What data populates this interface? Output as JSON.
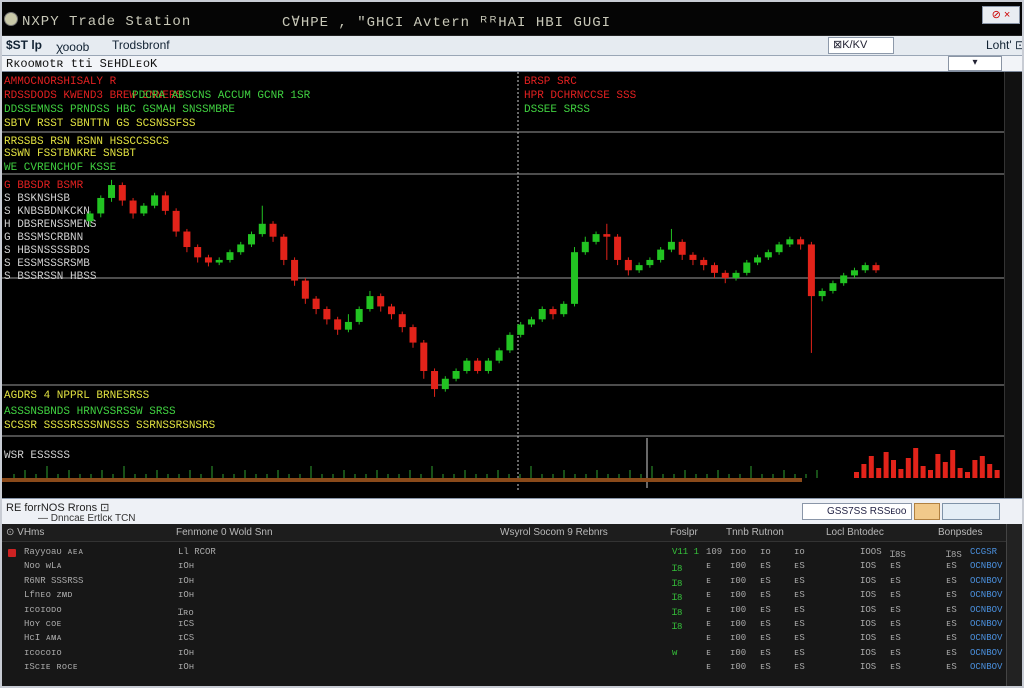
{
  "window": {
    "title": "NXPY Trade Station",
    "title_extra": "C∀HPE , \"GHCI Avtern ᴿᴿHAI HBI GUGI",
    "close_label": "⊘ ×"
  },
  "toolbar": {
    "items": [
      "$ST lp",
      "ꭓooob",
      "Trodsbronf"
    ],
    "right_field": "⊠K/KV",
    "right_label": "Loht' ⊡"
  },
  "toolbar2": {
    "label": "Rᴋooᴍᴏtʀ tti  SᴇHDLᴇᴏK",
    "combo": "▾"
  },
  "chart": {
    "left_legend_lines": [
      {
        "text": "AMMOCNORSHISALY R",
        "color": "#e02020"
      },
      {
        "text": "RDSSDODS KWEND3  BREW ENNERS",
        "color": "#e02020"
      },
      {
        "text": "DDSSEMNSS PRNDSS HBC  GSMAH SNSSMBRE",
        "color": "#40d040"
      },
      {
        "text": "SBTV  RSST  SBNTTN  GS  SCSNSSFSS",
        "color": "#e0e040"
      }
    ],
    "mid_legend_lines": [
      {
        "text": "BRSP SRC",
        "color": "#e02020"
      },
      {
        "text": "HPR DCHRNCCSE SSS",
        "color": "#e02020"
      },
      {
        "text": "DSSEE  SRSS",
        "color": "#40d040"
      }
    ],
    "top_right_legend": "PDCRA ABSCNS ACCUM  GCNR 1SR",
    "sub_header_1": "RRSSBS   RSN RSNN  HSSCCSSCS",
    "sub_header_2": "SSWN  FSSTBNKRE  SNSBT",
    "indicator_label": "WE   CVRENCHOF KSSE",
    "price_labels": [
      "G  BBSDR BSMR",
      "S  BSKNSHSB",
      "S  KNBSBDNKCKN",
      "H  DBSRENSSMENS",
      "G  BSSMSCRBNN",
      "S  HBSNSSSSBDS",
      "S  ESSMSSSRSMB",
      "S  BSSRSSN  HBSS"
    ],
    "lower_legend_1": "AGDRS  4  NPPRL  BRNESRSS",
    "lower_legend_2": "ASSSNSBNDS  HRNVSSRSSW SRSS",
    "lower_legend_3": "SCSSR  SSSSRSSSNNSSS  SSRNSSRSNSRS",
    "volume_label": "WSR  ESSSSS"
  },
  "chart_data": {
    "type": "candlestick",
    "candles": [
      {
        "o": 180,
        "c": 186,
        "h": 188,
        "l": 176
      },
      {
        "o": 186,
        "c": 198,
        "h": 200,
        "l": 183
      },
      {
        "o": 198,
        "c": 208,
        "h": 212,
        "l": 195
      },
      {
        "o": 208,
        "c": 196,
        "h": 210,
        "l": 192
      },
      {
        "o": 196,
        "c": 186,
        "h": 198,
        "l": 182
      },
      {
        "o": 186,
        "c": 192,
        "h": 194,
        "l": 184
      },
      {
        "o": 192,
        "c": 200,
        "h": 202,
        "l": 190
      },
      {
        "o": 200,
        "c": 188,
        "h": 203,
        "l": 185
      },
      {
        "o": 188,
        "c": 172,
        "h": 190,
        "l": 168
      },
      {
        "o": 172,
        "c": 160,
        "h": 174,
        "l": 156
      },
      {
        "o": 160,
        "c": 152,
        "h": 162,
        "l": 148
      },
      {
        "o": 152,
        "c": 148,
        "h": 154,
        "l": 145
      },
      {
        "o": 148,
        "c": 150,
        "h": 152,
        "l": 146
      },
      {
        "o": 150,
        "c": 156,
        "h": 158,
        "l": 148
      },
      {
        "o": 156,
        "c": 162,
        "h": 164,
        "l": 154
      },
      {
        "o": 162,
        "c": 170,
        "h": 172,
        "l": 160
      },
      {
        "o": 170,
        "c": 178,
        "h": 192,
        "l": 168
      },
      {
        "o": 178,
        "c": 168,
        "h": 180,
        "l": 164
      },
      {
        "o": 168,
        "c": 150,
        "h": 170,
        "l": 146
      },
      {
        "o": 150,
        "c": 134,
        "h": 152,
        "l": 130
      },
      {
        "o": 134,
        "c": 120,
        "h": 136,
        "l": 116
      },
      {
        "o": 120,
        "c": 112,
        "h": 122,
        "l": 108
      },
      {
        "o": 112,
        "c": 104,
        "h": 114,
        "l": 100
      },
      {
        "o": 104,
        "c": 96,
        "h": 106,
        "l": 92
      },
      {
        "o": 96,
        "c": 102,
        "h": 108,
        "l": 94
      },
      {
        "o": 102,
        "c": 112,
        "h": 114,
        "l": 100
      },
      {
        "o": 112,
        "c": 122,
        "h": 126,
        "l": 110
      },
      {
        "o": 122,
        "c": 114,
        "h": 124,
        "l": 110
      },
      {
        "o": 114,
        "c": 108,
        "h": 116,
        "l": 104
      },
      {
        "o": 108,
        "c": 98,
        "h": 110,
        "l": 94
      },
      {
        "o": 98,
        "c": 86,
        "h": 100,
        "l": 82
      },
      {
        "o": 86,
        "c": 64,
        "h": 88,
        "l": 58
      },
      {
        "o": 64,
        "c": 50,
        "h": 66,
        "l": 44
      },
      {
        "o": 50,
        "c": 58,
        "h": 60,
        "l": 48
      },
      {
        "o": 58,
        "c": 64,
        "h": 66,
        "l": 56
      },
      {
        "o": 64,
        "c": 72,
        "h": 74,
        "l": 62
      },
      {
        "o": 72,
        "c": 64,
        "h": 74,
        "l": 62
      },
      {
        "o": 64,
        "c": 72,
        "h": 74,
        "l": 62
      },
      {
        "o": 72,
        "c": 80,
        "h": 82,
        "l": 70
      },
      {
        "o": 80,
        "c": 92,
        "h": 94,
        "l": 78
      },
      {
        "o": 92,
        "c": 100,
        "h": 102,
        "l": 90
      },
      {
        "o": 100,
        "c": 104,
        "h": 106,
        "l": 98
      },
      {
        "o": 104,
        "c": 112,
        "h": 114,
        "l": 102
      },
      {
        "o": 112,
        "c": 108,
        "h": 114,
        "l": 104
      },
      {
        "o": 108,
        "c": 116,
        "h": 118,
        "l": 106
      },
      {
        "o": 116,
        "c": 156,
        "h": 160,
        "l": 114
      },
      {
        "o": 156,
        "c": 164,
        "h": 168,
        "l": 154
      },
      {
        "o": 164,
        "c": 170,
        "h": 172,
        "l": 162
      },
      {
        "o": 170,
        "c": 168,
        "h": 178,
        "l": 150
      },
      {
        "o": 168,
        "c": 150,
        "h": 170,
        "l": 146
      },
      {
        "o": 150,
        "c": 142,
        "h": 152,
        "l": 138
      },
      {
        "o": 142,
        "c": 146,
        "h": 148,
        "l": 140
      },
      {
        "o": 146,
        "c": 150,
        "h": 152,
        "l": 144
      },
      {
        "o": 150,
        "c": 158,
        "h": 160,
        "l": 148
      },
      {
        "o": 158,
        "c": 164,
        "h": 174,
        "l": 156
      },
      {
        "o": 164,
        "c": 154,
        "h": 166,
        "l": 150
      },
      {
        "o": 154,
        "c": 150,
        "h": 156,
        "l": 146
      },
      {
        "o": 150,
        "c": 146,
        "h": 152,
        "l": 142
      },
      {
        "o": 146,
        "c": 140,
        "h": 148,
        "l": 136
      },
      {
        "o": 140,
        "c": 136,
        "h": 142,
        "l": 132
      },
      {
        "o": 136,
        "c": 140,
        "h": 142,
        "l": 134
      },
      {
        "o": 140,
        "c": 148,
        "h": 150,
        "l": 138
      },
      {
        "o": 148,
        "c": 152,
        "h": 154,
        "l": 146
      },
      {
        "o": 152,
        "c": 156,
        "h": 158,
        "l": 150
      },
      {
        "o": 156,
        "c": 162,
        "h": 164,
        "l": 154
      },
      {
        "o": 162,
        "c": 166,
        "h": 168,
        "l": 160
      },
      {
        "o": 166,
        "c": 162,
        "h": 168,
        "l": 158
      },
      {
        "o": 162,
        "c": 122,
        "h": 164,
        "l": 78
      },
      {
        "o": 122,
        "c": 126,
        "h": 128,
        "l": 118
      },
      {
        "o": 126,
        "c": 132,
        "h": 134,
        "l": 124
      },
      {
        "o": 132,
        "c": 138,
        "h": 140,
        "l": 130
      },
      {
        "o": 138,
        "c": 142,
        "h": 144,
        "l": 136
      },
      {
        "o": 142,
        "c": 146,
        "h": 148,
        "l": 140
      },
      {
        "o": 146,
        "c": 142,
        "h": 148,
        "l": 140
      }
    ],
    "volume": [
      1,
      2,
      1,
      3,
      1,
      2,
      1,
      1,
      2,
      1,
      3,
      1,
      1,
      2,
      1,
      1,
      2,
      1,
      3,
      1,
      1,
      2,
      1,
      1,
      2,
      1,
      1,
      3,
      1,
      1,
      2,
      1,
      1,
      2,
      1,
      1,
      2,
      1,
      3,
      1,
      1,
      2,
      1,
      1,
      2,
      1,
      1,
      3,
      1,
      1,
      2,
      1,
      1,
      2,
      1,
      1,
      2,
      1,
      3,
      1,
      1,
      2,
      1,
      1,
      2,
      1,
      1,
      3,
      1,
      1,
      2,
      1,
      1,
      2
    ],
    "volume_spikes": [
      6,
      14,
      22,
      10,
      26,
      18,
      9,
      20,
      30,
      12,
      8,
      24,
      16,
      28,
      10,
      6,
      18,
      22,
      14,
      8
    ],
    "ylim": [
      40,
      215
    ],
    "colors": {
      "up": "#22c322",
      "down": "#e2231a",
      "volume_spike": "#e2231a"
    }
  },
  "orders_panel": {
    "title": "RE forrNOS Rrons ⊡",
    "subtitle": "— Dnncaᴇ Ertlcᴋ TCN",
    "search_text": "GSS7SS RSSᴇᴏᴏ"
  },
  "table": {
    "headers": [
      "⊙ VHms",
      "Fenmone 0 Wold Snn",
      "Wsyrol Socom 9 Rebnrs",
      "Foslpr",
      "Tnnb Rutnon",
      "Locl Bntodec",
      "Bonpsdes"
    ],
    "rows": [
      {
        "name": "Rayyᴏaᴜ ᴀᴇᴀ",
        "c2": "Ll RCOR",
        "c3": "",
        "c4": "V11 1",
        "c5": "109",
        "c6": "ɪᴏᴏ",
        "c7": "ɪᴏ",
        "c8": "IOOS",
        "c9": "Ɪ8S",
        "c10": "CCGSR"
      },
      {
        "name": "Noo ᴡLᴀ",
        "c2": "ɪOʜ",
        "c3": "",
        "c4": "Ɪ8",
        "c5": "ᴇ",
        "c6": "ɪ00",
        "c7": "ᴇS",
        "c8": "IOS",
        "c9": "ᴇS",
        "c10": "OCNBOV"
      },
      {
        "name": "R6NR SSSRSS",
        "c2": "ɪOʜ",
        "c3": "",
        "c4": "Ɪ8",
        "c5": "ᴇ",
        "c6": "ɪ00",
        "c7": "ᴇS",
        "c8": "IOS",
        "c9": "ᴇS",
        "c10": "OCNBOV"
      },
      {
        "name": "Lfnᴇᴏ ᴢᴍᴅ",
        "c2": "ɪOʜ",
        "c3": "",
        "c4": "Ɪ8",
        "c5": "ᴇ",
        "c6": "ɪ00",
        "c7": "ᴇS",
        "c8": "IOS",
        "c9": "ᴇS",
        "c10": "OCNBOV"
      },
      {
        "name": "ɪcᴏɪᴏᴅᴏ",
        "c2": "Ɪʀᴏ",
        "c3": "",
        "c4": "Ɪ8",
        "c5": "ᴇ",
        "c6": "ɪ00",
        "c7": "ᴇS",
        "c8": "IOS",
        "c9": "ᴇS",
        "c10": "OCNBOV"
      },
      {
        "name": "Hᴏʏ  ᴄᴏᴇ",
        "c2": "ɪCS",
        "c3": "",
        "c4": "Ɪ8",
        "c5": "ᴇ",
        "c6": "ɪ00",
        "c7": "ᴇS",
        "c8": "IOS",
        "c9": "ᴇS",
        "c10": "OCNBOV"
      },
      {
        "name": "HᴄI  ᴀᴍᴀ",
        "c2": "ɪCS",
        "c3": "",
        "c4": "",
        "c5": "ᴇ",
        "c6": "ɪ00",
        "c7": "ᴇS",
        "c8": "IOS",
        "c9": "ᴇS",
        "c10": "OCNBOV"
      },
      {
        "name": "ɪᴄᴏᴄᴏɪᴏ",
        "c2": "ɪOʜ",
        "c3": "",
        "c4": "ᴡ",
        "c5": "ᴇ",
        "c6": "ɪ00",
        "c7": "ᴇS",
        "c8": "IOS",
        "c9": "ᴇS",
        "c10": "OCNBOV"
      },
      {
        "name": "ɪSᴄɪᴇ ʀᴏᴄᴇ",
        "c2": "ɪOʜ",
        "c3": "",
        "c4": "",
        "c5": "ᴇ",
        "c6": "ɪ00",
        "c7": "ᴇS",
        "c8": "IOS",
        "c9": "ᴇS",
        "c10": "OCNBOV"
      }
    ]
  }
}
